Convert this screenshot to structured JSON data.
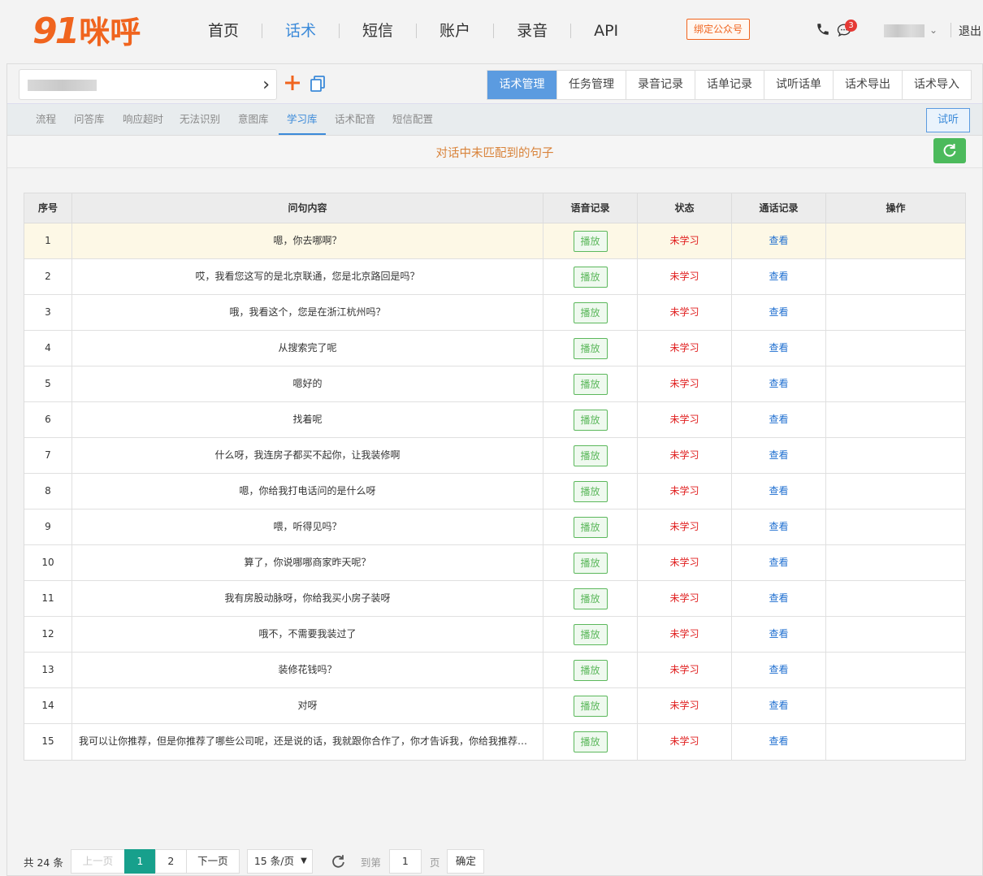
{
  "brand": {
    "logo_number": "91",
    "logo_text": "咪呼"
  },
  "topnav": {
    "items": [
      {
        "label": "首页",
        "active": false
      },
      {
        "label": "话术",
        "active": true
      },
      {
        "label": "短信",
        "active": false
      },
      {
        "label": "账户",
        "active": false
      },
      {
        "label": "录音",
        "active": false
      },
      {
        "label": "API",
        "active": false
      }
    ],
    "bind_button": "绑定公众号",
    "message_badge": "3",
    "logout": "退出"
  },
  "toolbar": {
    "tabs": [
      {
        "label": "话术管理",
        "active": true
      },
      {
        "label": "任务管理",
        "active": false
      },
      {
        "label": "录音记录",
        "active": false
      },
      {
        "label": "话单记录",
        "active": false
      },
      {
        "label": "试听话单",
        "active": false
      },
      {
        "label": "话术导出",
        "active": false
      },
      {
        "label": "话术导入",
        "active": false
      }
    ]
  },
  "subnav": {
    "items": [
      {
        "label": "流程",
        "active": false
      },
      {
        "label": "问答库",
        "active": false
      },
      {
        "label": "响应超时",
        "active": false
      },
      {
        "label": "无法识别",
        "active": false
      },
      {
        "label": "意图库",
        "active": false
      },
      {
        "label": "学习库",
        "active": true
      },
      {
        "label": "话术配音",
        "active": false
      },
      {
        "label": "短信配置",
        "active": false
      }
    ],
    "listen_button": "试听"
  },
  "section": {
    "title": "对话中未匹配到的句子"
  },
  "table": {
    "headers": [
      "序号",
      "问句内容",
      "语音记录",
      "状态",
      "通话记录",
      "操作"
    ],
    "play_label": "播放",
    "view_label": "查看",
    "rows": [
      {
        "no": "1",
        "content": "嗯，你去哪啊？",
        "status": "未学习"
      },
      {
        "no": "2",
        "content": "哎，我看您这写的是北京联通，您是北京路回是吗？",
        "status": "未学习"
      },
      {
        "no": "3",
        "content": "哦，我看这个，您是在浙江杭州吗？",
        "status": "未学习"
      },
      {
        "no": "4",
        "content": "从搜索完了呢",
        "status": "未学习"
      },
      {
        "no": "5",
        "content": "嗯好的",
        "status": "未学习"
      },
      {
        "no": "6",
        "content": "找着呢",
        "status": "未学习"
      },
      {
        "no": "7",
        "content": "什么呀，我连房子都买不起你，让我装修啊",
        "status": "未学习"
      },
      {
        "no": "8",
        "content": "嗯，你给我打电话问的是什么呀",
        "status": "未学习"
      },
      {
        "no": "9",
        "content": "喂，听得见吗？",
        "status": "未学习"
      },
      {
        "no": "10",
        "content": "算了，你说哪哪商家昨天呢？",
        "status": "未学习"
      },
      {
        "no": "11",
        "content": "我有房股动脉呀，你给我买小房子装呀",
        "status": "未学习"
      },
      {
        "no": "12",
        "content": "哦不，不需要我装过了",
        "status": "未学习"
      },
      {
        "no": "13",
        "content": "装修花钱吗？",
        "status": "未学习"
      },
      {
        "no": "14",
        "content": "对呀",
        "status": "未学习"
      },
      {
        "no": "15",
        "content": "我可以让你推荐，但是你推荐了哪些公司呢，还是说的话，我就跟你合作了，你才告诉我，你给我推荐哪...",
        "status": "未学习"
      }
    ]
  },
  "pager": {
    "total": "共 24 条",
    "prev": "上一页",
    "pages": [
      "1",
      "2"
    ],
    "current": "1",
    "next": "下一页",
    "page_size": "15 条/页",
    "goto_label": "到第",
    "goto_value": "1",
    "page_unit": "页",
    "confirm": "确定"
  },
  "colors": {
    "brand": "#f0641e",
    "accent": "#5b9be0",
    "success": "#5cb85c",
    "danger": "#e02020",
    "pager_active": "#17a08c"
  }
}
